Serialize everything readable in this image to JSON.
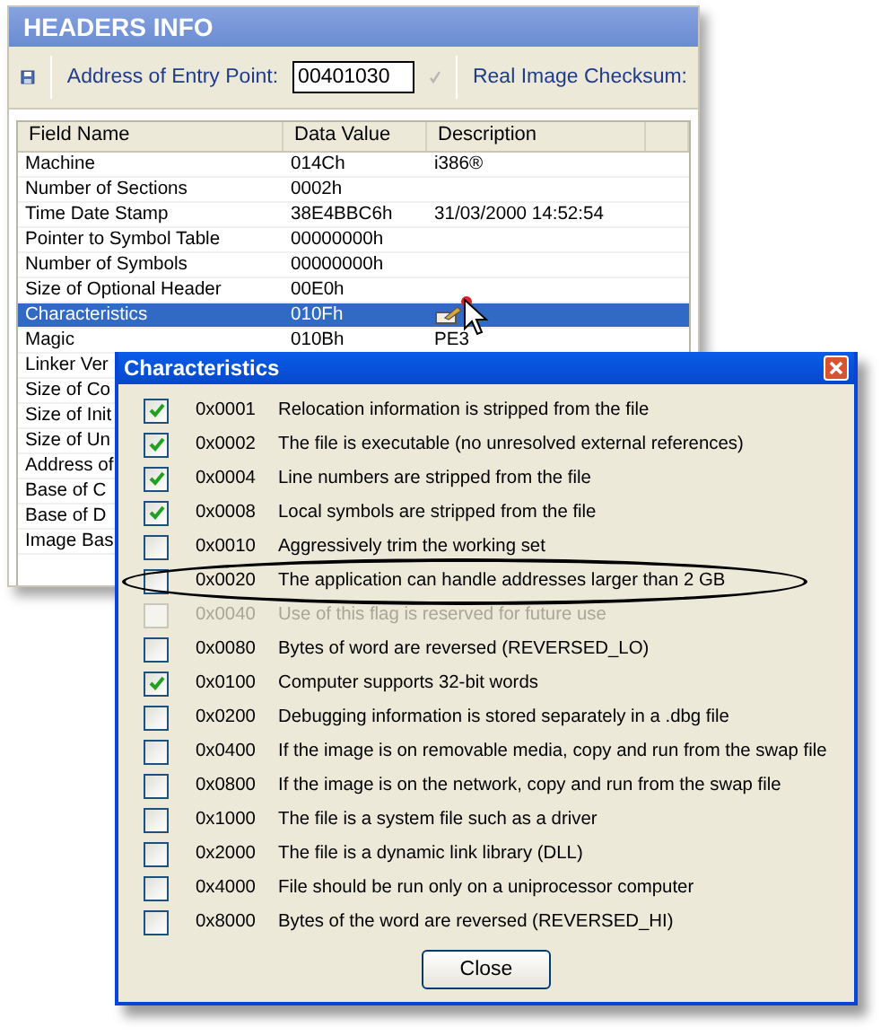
{
  "window": {
    "title": "HEADERS INFO"
  },
  "toolbar": {
    "entry_point_label": "Address of Entry Point:",
    "entry_point_value": "00401030",
    "checksum_label": "Real Image Checksum:"
  },
  "table": {
    "columns": [
      "Field Name",
      "Data Value",
      "Description"
    ],
    "rows": [
      {
        "kind": "plain",
        "field": "Machine",
        "value": "014Ch",
        "description": "i386®",
        "selected": false
      },
      {
        "kind": "plain",
        "field": "Number of Sections",
        "value": "0002h",
        "selected": false
      },
      {
        "kind": "plain",
        "field": "Time Date Stamp",
        "value": "38E4BBC6h",
        "description": "31/03/2000  14:52:54",
        "selected": false
      },
      {
        "kind": "plain",
        "field": "Pointer to Symbol Table",
        "value": "00000000h",
        "selected": false
      },
      {
        "kind": "plain",
        "field": "Number of Symbols",
        "value": "00000000h",
        "selected": false
      },
      {
        "kind": "plain",
        "field": "Size of Optional Header",
        "value": "00E0h",
        "selected": false
      },
      {
        "kind": "flags",
        "field": "Characteristics",
        "value": "010Fh",
        "selected": true
      },
      {
        "kind": "plain",
        "field": "Magic",
        "value": "010Bh",
        "description": "PE3",
        "selected": false
      },
      {
        "kind": "plain",
        "field": "Linker Ver",
        "selected": false
      },
      {
        "kind": "plain",
        "field": "Size of Co",
        "selected": false
      },
      {
        "kind": "plain",
        "field": "Size of Init",
        "selected": false
      },
      {
        "kind": "plain",
        "field": "Size of Un",
        "selected": false
      },
      {
        "kind": "plain",
        "field": "Address of",
        "selected": false
      },
      {
        "kind": "plain",
        "field": "Base of C",
        "selected": false
      },
      {
        "kind": "plain",
        "field": "Base of D",
        "selected": false
      },
      {
        "kind": "plain",
        "field": "Image Bas",
        "selected": false
      }
    ]
  },
  "dialog": {
    "title": "Characteristics",
    "close_button": "Close",
    "flags": [
      {
        "code": "0x0001",
        "text": "Relocation information is stripped from the file",
        "checked": true,
        "disabled": false,
        "highlighted": false
      },
      {
        "code": "0x0002",
        "text": "The file is executable (no unresolved external references)",
        "checked": true,
        "disabled": false,
        "highlighted": false
      },
      {
        "code": "0x0004",
        "text": "Line numbers are stripped from the file",
        "checked": true,
        "disabled": false,
        "highlighted": false
      },
      {
        "code": "0x0008",
        "text": "Local symbols are stripped from the file",
        "checked": true,
        "disabled": false,
        "highlighted": false
      },
      {
        "code": "0x0010",
        "text": "Aggressively trim the working set",
        "checked": false,
        "disabled": false,
        "highlighted": false
      },
      {
        "code": "0x0020",
        "text": "The application can handle addresses larger than 2 GB",
        "checked": false,
        "disabled": false,
        "highlighted": true
      },
      {
        "code": "0x0040",
        "text": "Use of this flag is reserved for future use",
        "checked": false,
        "disabled": true,
        "highlighted": false
      },
      {
        "code": "0x0080",
        "text": "Bytes of word are reversed (REVERSED_LO)",
        "checked": false,
        "disabled": false,
        "highlighted": false
      },
      {
        "code": "0x0100",
        "text": "Computer supports 32-bit words",
        "checked": true,
        "disabled": false,
        "highlighted": false
      },
      {
        "code": "0x0200",
        "text": "Debugging information is stored separately in a .dbg file",
        "checked": false,
        "disabled": false,
        "highlighted": false
      },
      {
        "code": "0x0400",
        "text": "If the image is on removable media, copy and run from the swap file",
        "checked": false,
        "disabled": false,
        "highlighted": false
      },
      {
        "code": "0x0800",
        "text": "If the image is on the network, copy and run from the swap file",
        "checked": false,
        "disabled": false,
        "highlighted": false
      },
      {
        "code": "0x1000",
        "text": "The file is a system file such as a driver",
        "checked": false,
        "disabled": false,
        "highlighted": false
      },
      {
        "code": "0x2000",
        "text": "The file is a dynamic link library (DLL)",
        "checked": false,
        "disabled": false,
        "highlighted": false
      },
      {
        "code": "0x4000",
        "text": "File should be run only on a uniprocessor computer",
        "checked": false,
        "disabled": false,
        "highlighted": false
      },
      {
        "code": "0x8000",
        "text": "Bytes of the word are reversed (REVERSED_HI)",
        "checked": false,
        "disabled": false,
        "highlighted": false
      }
    ]
  }
}
